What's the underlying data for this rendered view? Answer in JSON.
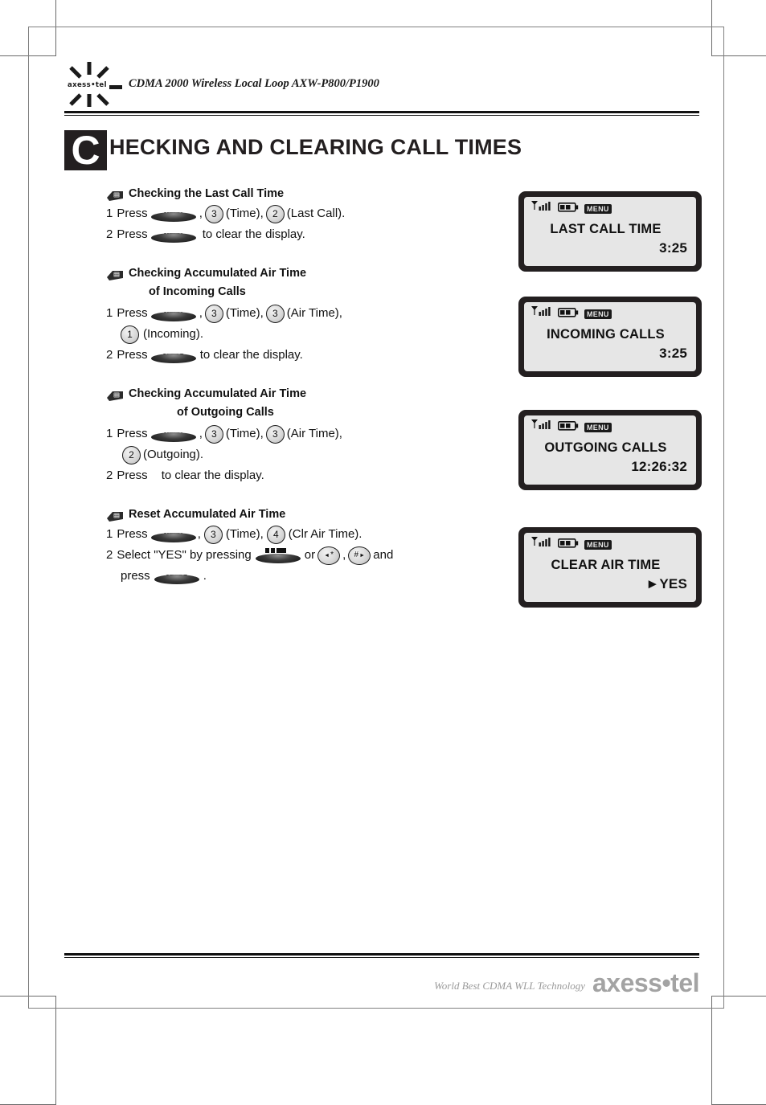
{
  "header": {
    "logo_wordmark": "axess•tel",
    "title": "CDMA 2000 Wireless Local Loop AXW-P800/P1900"
  },
  "chapter": {
    "dropcap": "C",
    "title": "HECKING AND CLEARING CALL TIMES"
  },
  "sections": [
    {
      "title": "Checking the Last Call Time",
      "title2": "",
      "steps": [
        {
          "num": "1",
          "press": "Press",
          "key": "MENU",
          "parts": [
            ", ",
            "(Time), ",
            "(Last Call)."
          ],
          "keys": [
            "3",
            "2"
          ]
        },
        {
          "num": "2",
          "press": "Press",
          "key": "MENU",
          "tail": "to clear the display."
        }
      ]
    },
    {
      "title": "Checking Accumulated Air Time",
      "title2": "of Incoming Calls",
      "steps": [
        {
          "num": "1",
          "press": "Press",
          "key": "MENU",
          "parts": [
            ", ",
            "(Time), ",
            "(Air Time),"
          ],
          "keys": [
            "3",
            "3"
          ]
        },
        {
          "num": "",
          "cont_key": "1",
          "cont_text": "(Incoming)."
        },
        {
          "num": "2",
          "press": "Press",
          "key": "CLEAR",
          "tail": "to clear the display."
        }
      ]
    },
    {
      "title": "Checking Accumulated Air Time",
      "title2": "of Outgoing Calls",
      "steps": [
        {
          "num": "1",
          "press": "Press",
          "key": "MENU",
          "parts": [
            ", ",
            "(Time), ",
            "(Air Time),"
          ],
          "keys": [
            "3",
            "3"
          ]
        },
        {
          "num": "",
          "cont_key": "2",
          "cont_text": "(Outgoing)."
        },
        {
          "num": "2",
          "press": "Press",
          "tail": "to clear the display."
        }
      ]
    },
    {
      "title": "Reset Accumulated Air Time",
      "title2": "",
      "steps": [
        {
          "num": "1",
          "press": "Press",
          "key": "MENU",
          "parts": [
            ", ",
            "(Time), ",
            "(Clr Air Time)."
          ],
          "keys": [
            "3",
            "4"
          ]
        },
        {
          "num": "2",
          "select_text": "Select \"YES\" by pressing",
          "nav_key": "",
          "or_text": "or",
          "star_key": "*",
          "hash_key": "#",
          "and_text": "and"
        },
        {
          "num": "",
          "press2": "press",
          "key2": "STORE",
          "period": "."
        }
      ]
    }
  ],
  "displays": [
    {
      "menu_badge": "MENU",
      "line1": "LAST CALL TIME",
      "line2": "3:25"
    },
    {
      "menu_badge": "MENU",
      "line1": "INCOMING CALLS",
      "line2": "3:25"
    },
    {
      "menu_badge": "MENU",
      "line1": "OUTGOING CALLS",
      "line2": "12:26:32"
    },
    {
      "menu_badge": "MENU",
      "line1": "CLEAR AIR TIME",
      "line2": "►YES"
    }
  ],
  "footer": {
    "tagline": "World Best CDMA WLL Technology",
    "logo": "axess•tel"
  }
}
